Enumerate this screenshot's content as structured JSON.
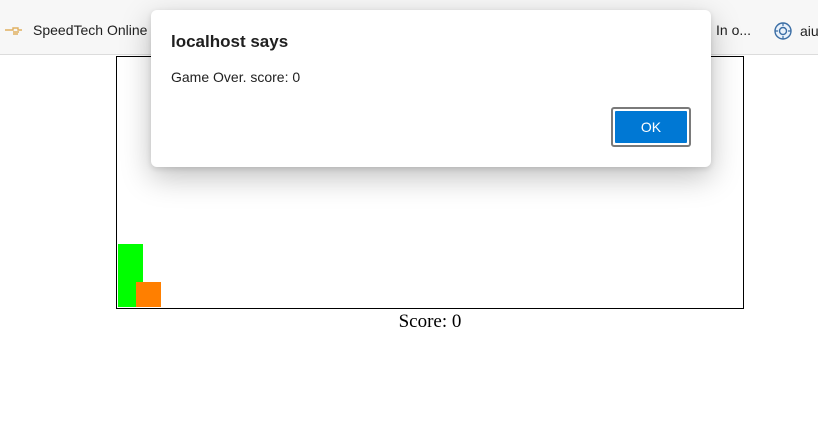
{
  "bookmarks": {
    "left_item": {
      "label": "SpeedTech Online",
      "icon": "hand-icon"
    },
    "right_item_1": {
      "label": "In o..."
    },
    "right_item_2": {
      "label": "aiu",
      "icon": "globe-icon"
    }
  },
  "game": {
    "score_label": "Score: 0",
    "colors": {
      "player": "#00ff00",
      "obstacle": "#ff7f00"
    }
  },
  "dialog": {
    "title": "localhost says",
    "message": "Game Over. score: 0",
    "ok_label": "OK",
    "accent_color": "#0078d4"
  }
}
